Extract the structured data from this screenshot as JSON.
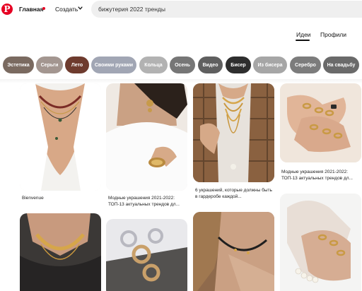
{
  "header": {
    "logo_letter": "P",
    "nav_home": "Главная",
    "nav_create": "Создать",
    "search_value": "бижутерия 2022 тренды"
  },
  "tabs": {
    "ideas": "Идеи",
    "profiles": "Профили"
  },
  "chips": [
    {
      "label": "Эстетика",
      "color": "#7a6a60"
    },
    {
      "label": "Серьги",
      "color": "#a39690"
    },
    {
      "label": "Лето",
      "color": "#6e3b2e"
    },
    {
      "label": "Своими руками",
      "color": "#a1a6b4"
    },
    {
      "label": "Кольца",
      "color": "#b2b2b2"
    },
    {
      "label": "Осень",
      "color": "#767676"
    },
    {
      "label": "Видео",
      "color": "#5f5f5f"
    },
    {
      "label": "Бисер",
      "color": "#2e2e2e"
    },
    {
      "label": "Из бисера",
      "color": "#a6a6a6"
    },
    {
      "label": "Серебро",
      "color": "#7c7c7c"
    },
    {
      "label": "На свадьбу",
      "color": "#6a6a6a"
    }
  ],
  "pins": [
    {
      "caption": "Bienvenue"
    },
    {
      "caption": "Модные украшения 2021-2022: ТОП-13 актуальных трендов дл..."
    },
    {
      "caption": "6 украшений, которые должны быть в гардеробе каждой..."
    },
    {
      "caption": "Модные украшения 2021-2022: ТОП-13 актуальных трендов дл..."
    }
  ]
}
